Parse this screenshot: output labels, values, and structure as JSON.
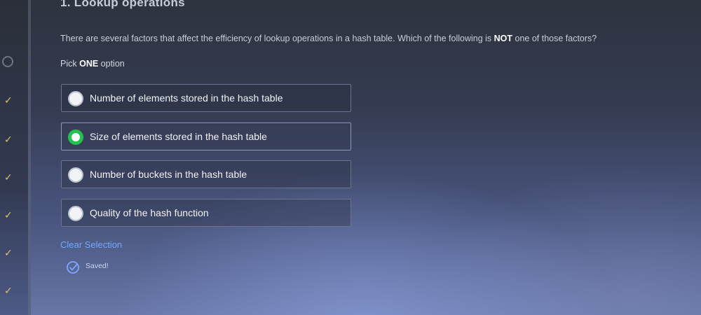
{
  "question": {
    "title": "1. Lookup operations",
    "text_before": "There are several factors that affect the efficiency of lookup operations in a hash table. Which of the following is ",
    "text_emphasis": "NOT",
    "text_after": " one of those factors?",
    "pick_prefix": "Pick ",
    "pick_emphasis": "ONE",
    "pick_suffix": " option"
  },
  "options": [
    {
      "label": "Number of elements stored in the hash table",
      "selected": false
    },
    {
      "label": "Size of elements stored in the hash table",
      "selected": true
    },
    {
      "label": "Number of buckets in the hash table",
      "selected": false
    },
    {
      "label": "Quality of the hash function",
      "selected": false
    }
  ],
  "clear_selection_label": "Clear Selection",
  "saved_label": "Saved!",
  "icons": {
    "selected_radio": "selected-radio-icon",
    "saved": "check-circle-icon",
    "rail_status": "check-icon"
  },
  "colors": {
    "accent_green": "#24c24d",
    "link_blue": "#6fa9ff",
    "rail_check": "#d8c56a"
  }
}
